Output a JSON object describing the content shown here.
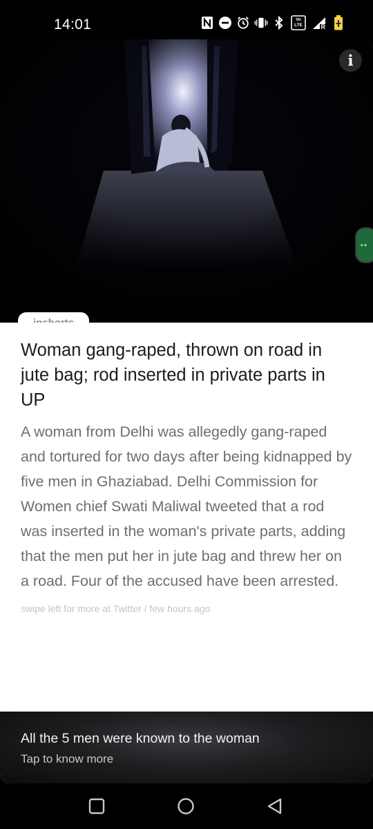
{
  "status_bar": {
    "time": "14:01",
    "icons": [
      "nfc-icon",
      "dnd-icon",
      "alarm-icon",
      "vibrate-icon",
      "bluetooth-icon",
      "volte-icon",
      "signal-icon",
      "battery-icon"
    ],
    "volte_label": "Vo LTE",
    "signal_badge": "R"
  },
  "article": {
    "source": "inshorts",
    "headline": "Woman gang-raped, thrown on road in jute bag; rod inserted in private parts in UP",
    "summary": "A woman from Delhi was allegedly gang-raped and tortured for two days after being kidnapped by five men in Ghaziabad. Delhi Commission for Women chief Swati Maliwal tweeted that a rod was inserted in the woman's private parts, adding that the men put her in jute bag and threw her on a road. Four of the accused have been arrested.",
    "meta": "swipe left for more at Twitter / few hours ago",
    "info_icon": "info-icon"
  },
  "footer": {
    "title": "All the 5 men were known to the woman",
    "subtitle": "Tap to know more"
  },
  "nav": {
    "icons": [
      "recents-icon",
      "home-icon",
      "back-icon"
    ]
  },
  "colors": {
    "card_bg": "#ffffff",
    "headline": "#1c1c1c",
    "summary": "#6e6e6e",
    "meta": "#c4c4c4",
    "side_handle": "#1f6a3a"
  }
}
